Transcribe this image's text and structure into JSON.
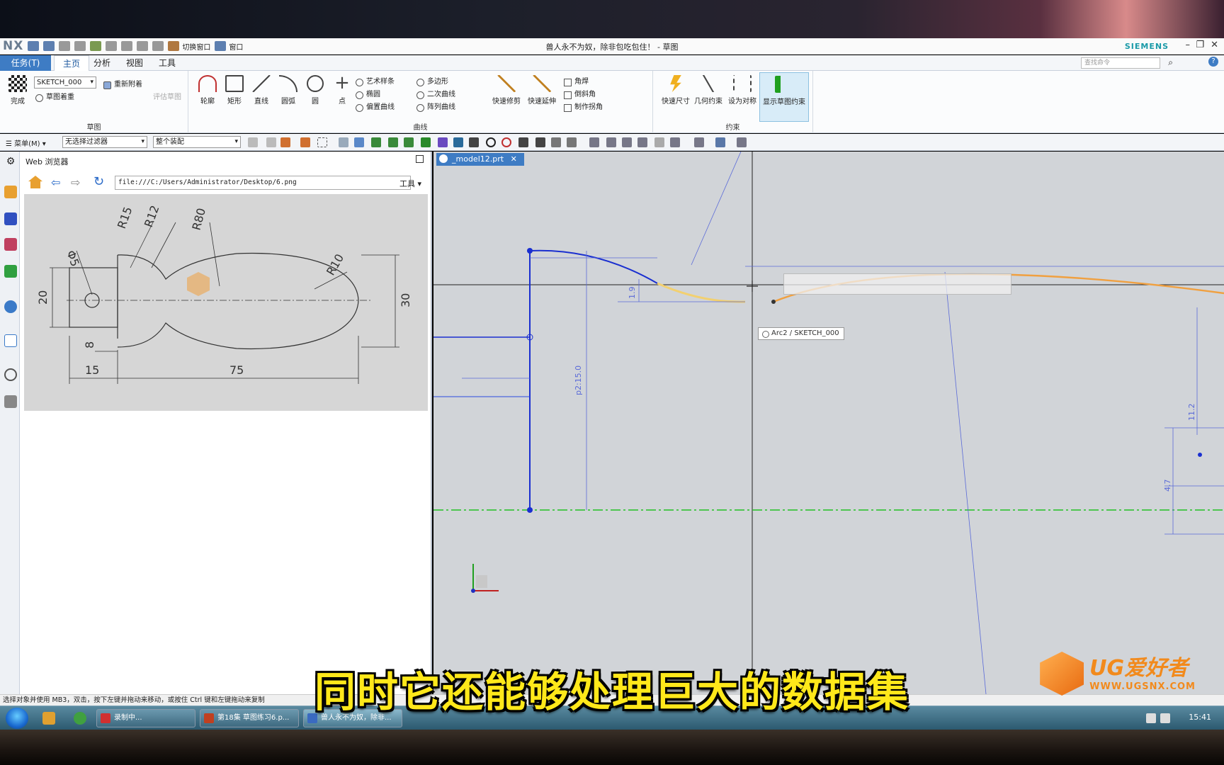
{
  "titlebar": {
    "logo": "NX",
    "quick_access": [
      "切换窗口",
      "窗口"
    ],
    "title": "兽人永不为奴，除非包吃包住！ - 草图",
    "brand": "SIEMENS"
  },
  "menu_tabs": {
    "task": "任务(T)",
    "home": "主页",
    "analysis": "分析",
    "view": "视图",
    "tools": "工具",
    "search_placeholder": "查找命令"
  },
  "ribbon": {
    "sketch_group": {
      "label": "草图",
      "finish": "完成",
      "sketch_name": "SKETCH_000",
      "reattach": "重新附着",
      "orient": "草图着重",
      "evaluate": "评估草图"
    },
    "curve_group": {
      "label": "曲线",
      "tools": [
        "轮廓",
        "矩形",
        "直线",
        "圆弧",
        "圆",
        "点"
      ],
      "small_tools": [
        "艺术样条",
        "椭圆",
        "偏置曲线",
        "多边形",
        "二次曲线",
        "阵列曲线"
      ],
      "quick_trim": "快速修剪",
      "quick_extend": "快速延伸",
      "edit_tools": [
        "角焊",
        "倒斜角",
        "制作拐角"
      ]
    },
    "constraint_group": {
      "label": "约束",
      "tools": [
        "快速尺寸",
        "几何约束",
        "设为对称",
        "显示草图约束"
      ]
    }
  },
  "toolbar2": {
    "menu": "菜单(M)",
    "filter": "无选择过滤器",
    "assembly": "整个装配"
  },
  "web_panel": {
    "title": "Web 浏览器",
    "url": "file:///C:/Users/Administrator/Desktop/6.png",
    "tools": "工具",
    "drawing_labels": {
      "phi5": "Φ5",
      "r15": "R15",
      "r12": "R12",
      "r80": "R80",
      "r10": "R10",
      "d20": "20",
      "d30": "30",
      "d8": "8",
      "d15": "15",
      "d75": "75"
    }
  },
  "graphics": {
    "doc_tab": "_model12.prt",
    "tooltip": "Arc2 / SKETCH_000",
    "dims": [
      "p2:15.0",
      "1.9",
      "11.2",
      "4.7"
    ]
  },
  "statusbar": {
    "text": "选择对象并使用 MB3，双击，按下左键并拖动来移动，或按住 Ctrl 键和左键拖动来复制"
  },
  "taskbar": {
    "items": [
      "录制中...",
      "第18集 草图练习6.p...",
      "兽人永不为奴，除非..."
    ],
    "clock": "15:41"
  },
  "overlay": {
    "subtitle": "同时它还能够处理巨大的数据集",
    "watermark_brand": "UG爱好者",
    "watermark_url": "WWW.UGSNX.COM"
  },
  "colors": {
    "accent": "#3e7cc4",
    "sketch_blue": "#1a2fd0",
    "highlight_orange": "#f0a040",
    "axis_green": "#22c022",
    "subtitle_yellow": "#ffe81a"
  }
}
